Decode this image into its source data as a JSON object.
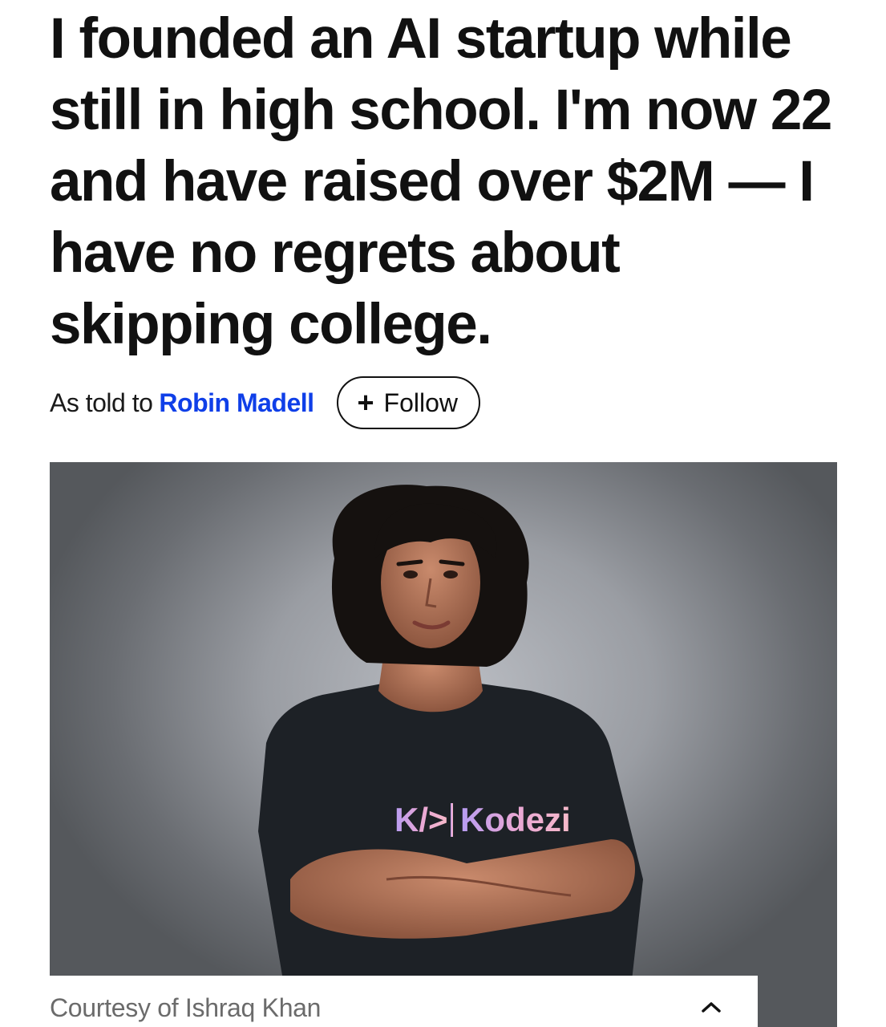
{
  "article": {
    "headline": "I founded an AI startup while still in high school. I'm now 22 and have raised over $2M — I have no regrets about skipping college.",
    "byline_prefix": "As told to",
    "author": "Robin Madell",
    "follow_label": "Follow",
    "follow_icon": "plus-icon"
  },
  "photo": {
    "shirt_logo_text": "Kodezi",
    "caption": "Courtesy of Ishraq Khan",
    "collapse_icon": "chevron-up-icon"
  },
  "colors": {
    "author_link": "#0f3fe8",
    "text": "#111111",
    "caption": "#6b6b6b"
  }
}
